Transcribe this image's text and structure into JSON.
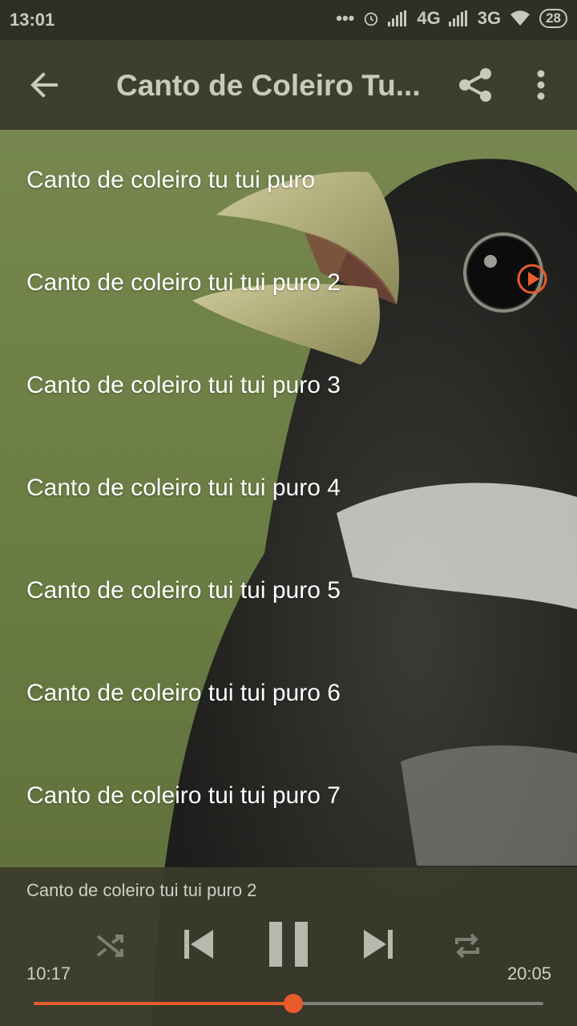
{
  "status_bar": {
    "time": "13:01",
    "network_1": "4G",
    "network_2": "3G",
    "battery": "28"
  },
  "toolbar": {
    "title": "Canto de Coleiro Tu..."
  },
  "tracks": [
    {
      "label": "Canto de coleiro tu tui puro"
    },
    {
      "label": "Canto de coleiro tui tui puro 2",
      "playing": true
    },
    {
      "label": "Canto de coleiro tui tui puro 3"
    },
    {
      "label": "Canto de coleiro tui tui puro 4"
    },
    {
      "label": "Canto de coleiro tui tui puro 5"
    },
    {
      "label": "Canto de coleiro tui tui puro 6"
    },
    {
      "label": "Canto de coleiro tui tui puro 7"
    }
  ],
  "player": {
    "now_playing": "Canto de coleiro tui tui puro 2",
    "elapsed": "10:17",
    "total": "20:05",
    "progress": 0.51
  },
  "colors": {
    "accent": "#e85b2d",
    "toolbar": "#3e3e2e",
    "status_bar": "#2f2f24"
  },
  "icons": [
    "back-arrow-icon",
    "share-icon",
    "more-vert-icon",
    "play-circle-icon",
    "shuffle-icon",
    "skip-previous-icon",
    "pause-icon",
    "skip-next-icon",
    "repeat-icon",
    "signal-icon",
    "wifi-icon",
    "alarm-icon"
  ]
}
